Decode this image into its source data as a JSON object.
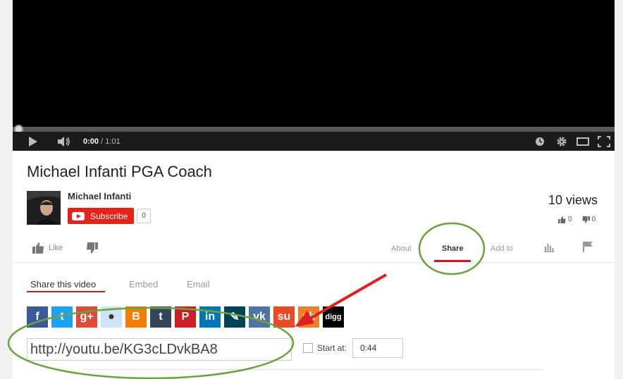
{
  "player": {
    "current_time": "0:00",
    "duration": "/ 1:01",
    "icons": [
      "play-icon",
      "volume-icon",
      "watch-later-icon",
      "gear-icon",
      "theater-mode-icon",
      "fullscreen-icon"
    ]
  },
  "video": {
    "title": "Michael Infanti PGA Coach",
    "channel_name": "Michael Infanti",
    "subscribe_label": "Subscribe",
    "subscriber_count": "0",
    "views": "10 views",
    "mini_likes": "0",
    "mini_dislikes": "0"
  },
  "actions": {
    "like_label": "Like",
    "tabs": {
      "about": "About",
      "share": "Share",
      "add_to": "Add to"
    }
  },
  "share": {
    "sub_tabs": {
      "share_video": "Share this video",
      "embed": "Embed",
      "email": "Email"
    },
    "services": [
      {
        "name": "facebook",
        "glyph": "f",
        "color": "#3b5998"
      },
      {
        "name": "twitter",
        "glyph": "t",
        "color": "#1da1f2"
      },
      {
        "name": "google-plus",
        "glyph": "g+",
        "color": "#dd4b39"
      },
      {
        "name": "reddit",
        "glyph": "●",
        "color": "#cee3f8"
      },
      {
        "name": "blogger",
        "glyph": "B",
        "color": "#f57d00"
      },
      {
        "name": "tumblr",
        "glyph": "t",
        "color": "#35465c"
      },
      {
        "name": "pinterest",
        "glyph": "P",
        "color": "#cb2027"
      },
      {
        "name": "linkedin",
        "glyph": "in",
        "color": "#0077b5"
      },
      {
        "name": "livejournal",
        "glyph": "✎",
        "color": "#004359"
      },
      {
        "name": "vk",
        "glyph": "vk",
        "color": "#4c75a3"
      },
      {
        "name": "stumbleupon",
        "glyph": "su",
        "color": "#eb4924"
      },
      {
        "name": "odnoklassniki",
        "glyph": "ok",
        "color": "#ed812b"
      },
      {
        "name": "digg",
        "glyph": "digg",
        "color": "#000000"
      }
    ],
    "url": "http://youtu.be/KG3cLDvkBA8",
    "start_label": "Start at:",
    "start_value": "0:44"
  },
  "colors": {
    "accent_red": "#cc181e",
    "annotation_green": "#6aa33b",
    "annotation_arrow": "#e02020"
  }
}
